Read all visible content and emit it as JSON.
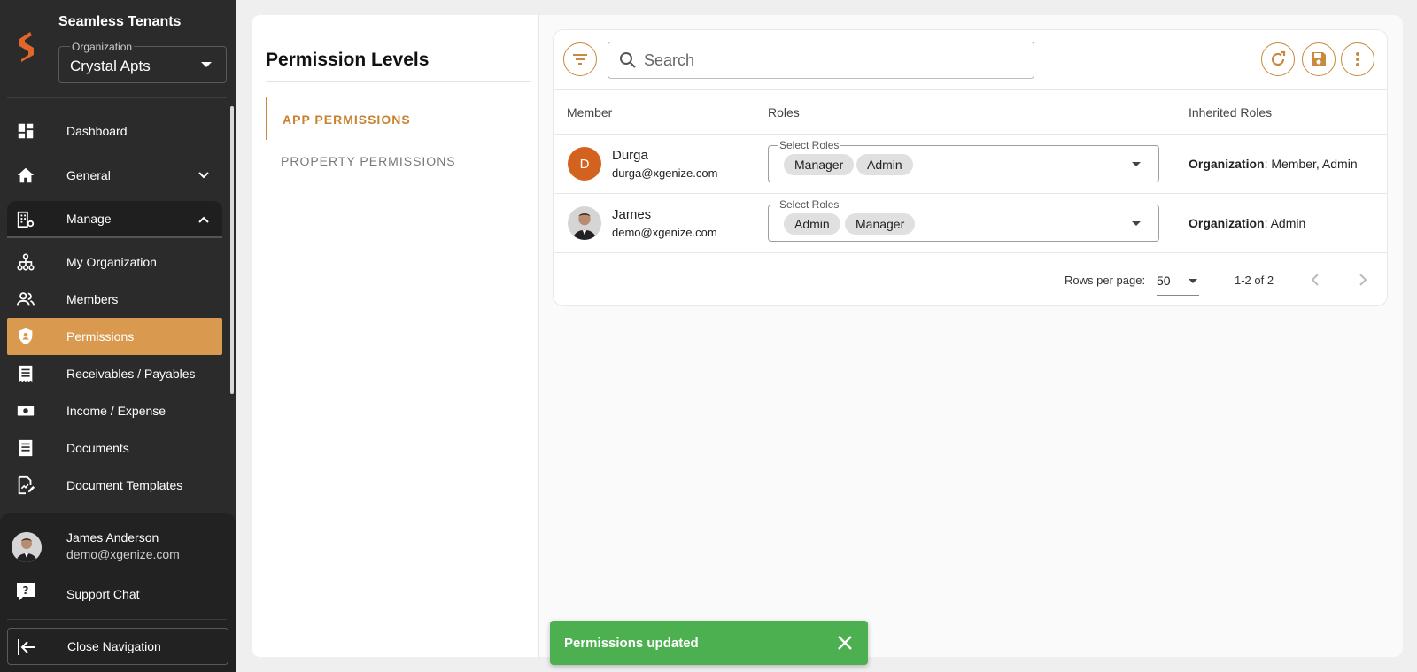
{
  "app": {
    "brand": "Seamless Tenants",
    "organization_label": "Organization",
    "organization_value": "Crystal Apts",
    "brand_color": "#e0662a",
    "accent_color": "#c98a3d"
  },
  "sidebar": {
    "items": [
      {
        "label": "Dashboard",
        "icon": "dashboard-icon"
      },
      {
        "label": "General",
        "icon": "home-icon"
      },
      {
        "label": "Manage",
        "icon": "building-gear-icon"
      },
      {
        "label": "My Organization",
        "icon": "org-tree-icon"
      },
      {
        "label": "Members",
        "icon": "people-icon"
      },
      {
        "label": "Permissions",
        "icon": "shield-user-icon"
      },
      {
        "label": "Receivables / Payables",
        "icon": "receipt-icon"
      },
      {
        "label": "Income / Expense",
        "icon": "money-icon"
      },
      {
        "label": "Documents",
        "icon": "document-icon"
      },
      {
        "label": "Document Templates",
        "icon": "document-edit-icon"
      }
    ],
    "active": "Permissions",
    "user": {
      "name": "James Anderson",
      "email": "demo@xgenize.com"
    },
    "support_label": "Support Chat",
    "close_label": "Close Navigation"
  },
  "permissions": {
    "title": "Permission Levels",
    "tabs": [
      {
        "label": "APP PERMISSIONS",
        "active": true
      },
      {
        "label": "PROPERTY PERMISSIONS",
        "active": false
      }
    ]
  },
  "toolbar": {
    "search_placeholder": "Search"
  },
  "table": {
    "columns": [
      "Member",
      "Roles",
      "Inherited Roles"
    ],
    "roles_legend": "Select Roles",
    "rows": [
      {
        "initial": "D",
        "name": "Durga",
        "email": "durga@xgenize.com",
        "roles": [
          "Manager",
          "Admin"
        ],
        "inherited_label": "Organization",
        "inherited_value": ": Member, Admin"
      },
      {
        "initial": "",
        "name": "James",
        "email": "demo@xgenize.com",
        "roles": [
          "Admin",
          "Manager"
        ],
        "inherited_label": "Organization",
        "inherited_value": ": Admin"
      }
    ],
    "rows_per_page_label": "Rows per page:",
    "rows_per_page": "50",
    "page_info": "1-2 of 2"
  },
  "toast": {
    "message": "Permissions updated",
    "color": "#4caf50"
  }
}
